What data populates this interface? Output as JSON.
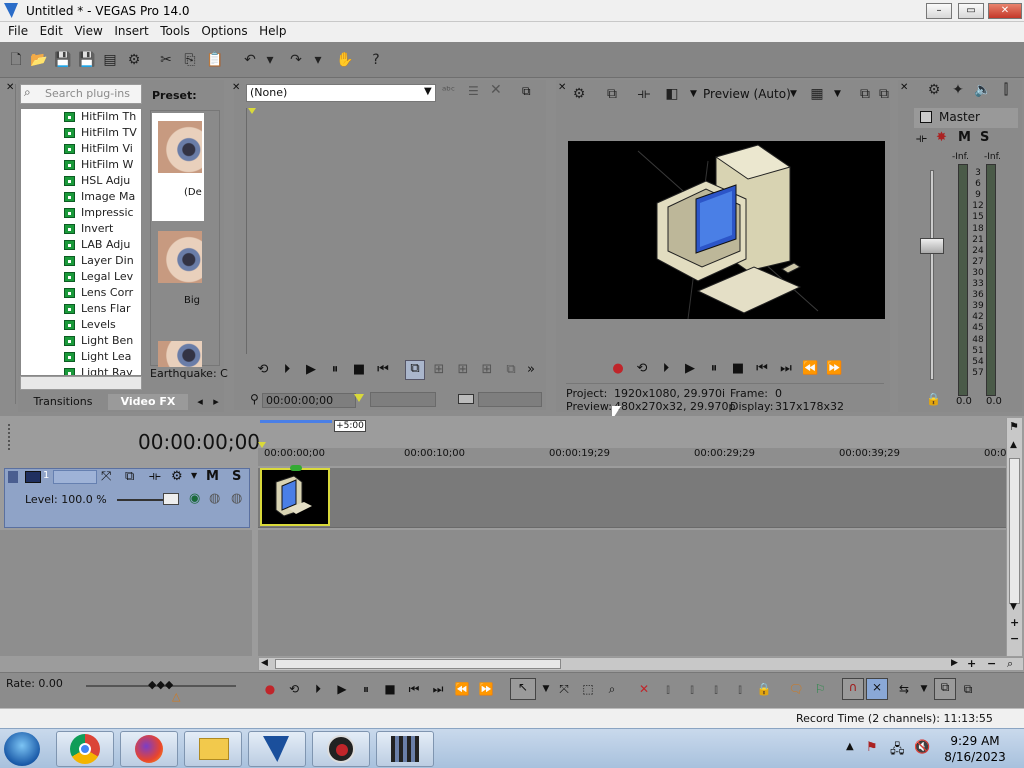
{
  "window": {
    "title": "Untitled * - VEGAS Pro 14.0",
    "minimize": "–",
    "maximize": "▭",
    "close": "✕"
  },
  "menu": [
    "File",
    "Edit",
    "View",
    "Insert",
    "Tools",
    "Options",
    "Help"
  ],
  "plugins": {
    "search_placeholder": "Search plug-ins",
    "items": [
      "HitFilm Th",
      "HitFilm TV",
      "HitFilm Vi",
      "HitFilm W",
      "HSL Adju",
      "Image Ma",
      "Impressic",
      "Invert",
      "LAB Adju",
      "Layer Din",
      "Legal Lev",
      "Lens Corr",
      "Lens Flar",
      "Levels",
      "Light Ben",
      "Light Lea",
      "Light Ray"
    ],
    "preset_label": "Preset:",
    "presets": [
      "(De",
      "Big"
    ],
    "preset_footer": "Earthquake: C",
    "tabs": [
      "Transitions",
      "Video FX"
    ]
  },
  "trimmer": {
    "dropdown_value": "(None)",
    "timecode": "00:00:00;00"
  },
  "preview": {
    "mode": "Preview (Auto)",
    "project_label": "Project:",
    "project_value": "1920x1080, 29.970i",
    "preview_label": "Preview:",
    "preview_value": "480x270x32, 29.970p",
    "frame_label": "Frame:",
    "frame_value": "0",
    "display_label": "Display:",
    "display_value": "317x178x32"
  },
  "mixer": {
    "master": "Master",
    "mute": "M",
    "solo": "S",
    "inf_left": "-Inf.",
    "inf_right": "-Inf.",
    "scale": [
      "3",
      "6",
      "9",
      "12",
      "15",
      "18",
      "21",
      "24",
      "27",
      "30",
      "33",
      "36",
      "39",
      "42",
      "45",
      "48",
      "51",
      "54",
      "57"
    ],
    "val_left": "0.0",
    "val_right": "0.0"
  },
  "timeline": {
    "timecode": "00:00:00;00",
    "marker": "+5:00",
    "ruler": [
      "00:00:00;00",
      "00:00:10;00",
      "00:00:19;29",
      "00:00:29;29",
      "00:00:39;29",
      "00:0"
    ],
    "track_number": "1",
    "track_m": "M",
    "track_s": "S",
    "level": "Level: 100.0 %",
    "rate": "Rate: 0.00"
  },
  "status": {
    "record_time": "Record Time (2 channels): 11:13:55"
  },
  "taskbar": {
    "time": "9:29 AM",
    "date": "8/16/2023"
  },
  "colors": {
    "accent_yellow": "#d9d93a",
    "track_blue": "#8fa3c7",
    "record_red": "#c0252a"
  }
}
